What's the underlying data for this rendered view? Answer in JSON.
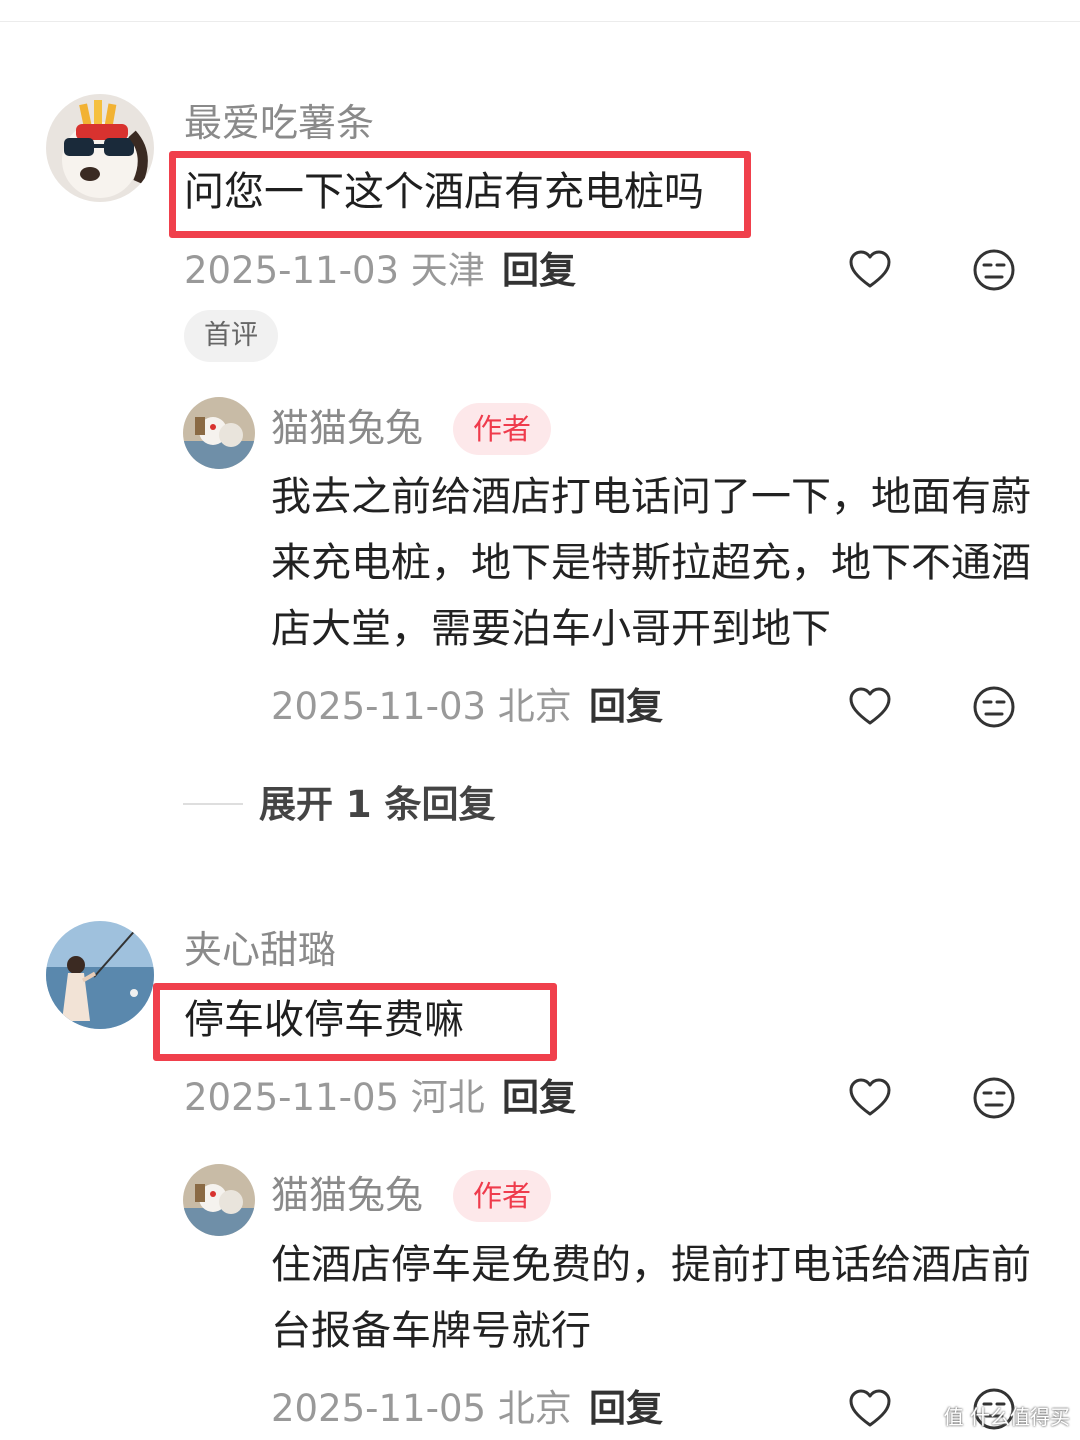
{
  "comments": [
    {
      "username": "最爱吃薯条",
      "text": "问您一下这个酒店有充电桩吗",
      "date_location": "2025-11-03 天津",
      "reply_label": "回复",
      "tag": "首评",
      "reply": {
        "username": "猫猫兔兔",
        "badge": "作者",
        "text": "我去之前给酒店打电话问了一下，地面有蔚来充电桩，地下是特斯拉超充，地下不通酒店大堂，需要泊车小哥开到地下",
        "date_location": "2025-11-03 北京",
        "reply_label": "回复"
      },
      "expand_label": "展开 1 条回复"
    },
    {
      "username": "夹心甜璐",
      "text": "停车收停车费嘛",
      "date_location": "2025-11-05 河北",
      "reply_label": "回复",
      "reply": {
        "username": "猫猫兔兔",
        "badge": "作者",
        "text": "住酒店停车是免费的，提前打电话给酒店前台报备车牌号就行",
        "date_location": "2025-11-05 北京",
        "reply_label": "回复"
      }
    }
  ],
  "icons": {
    "like": "heart-outline-icon",
    "dislike": "unamused-face-icon"
  },
  "colors": {
    "highlight": "#f0404c",
    "author_badge_bg": "#fde8ea",
    "author_badge_text": "#ef3b4c"
  },
  "watermark": "值 什么值得买"
}
